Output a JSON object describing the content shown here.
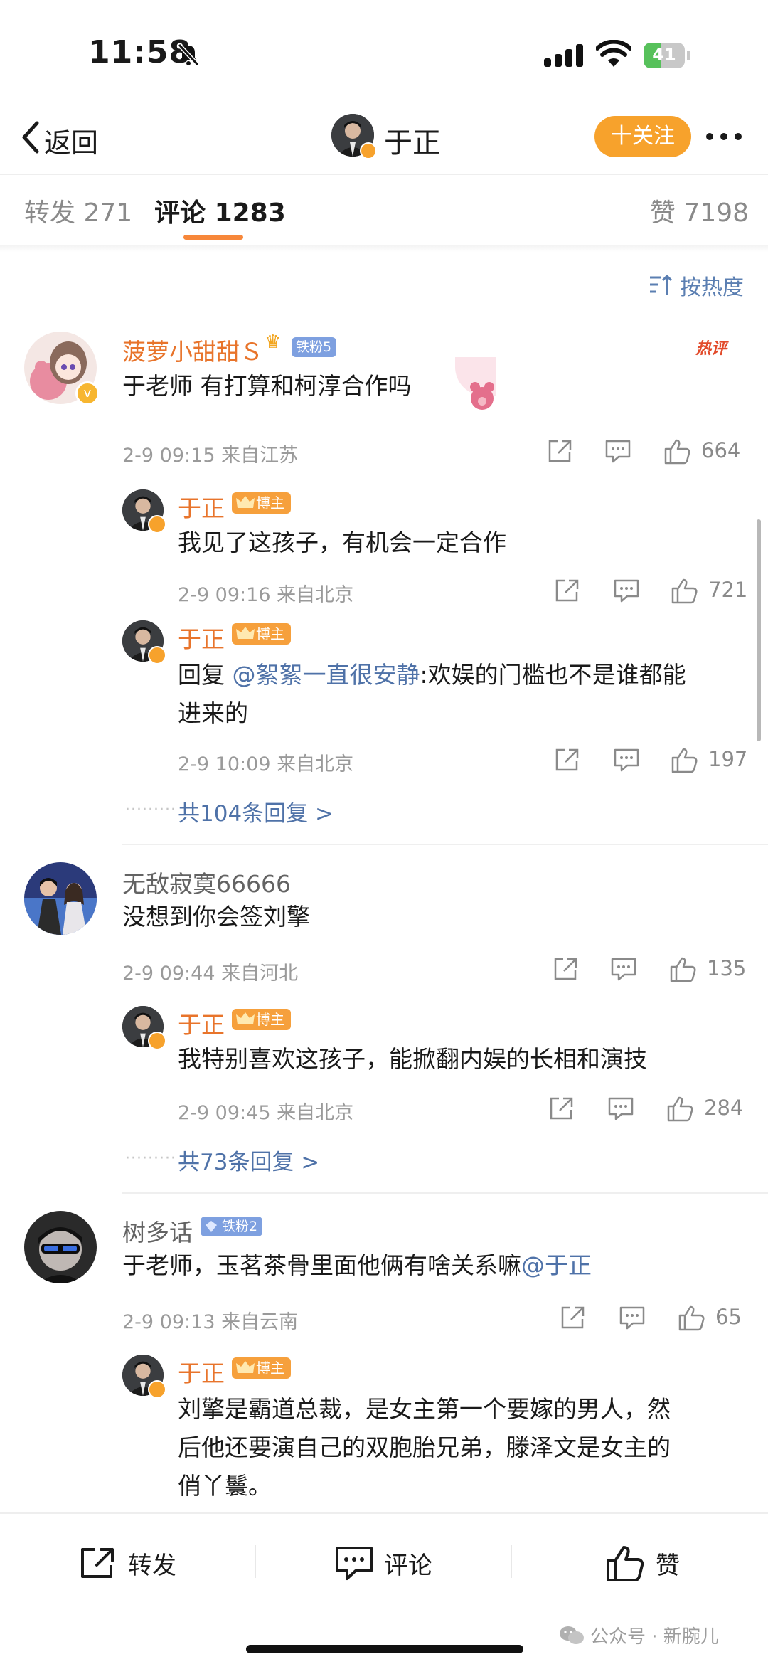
{
  "status_bar": {
    "time": "11:58",
    "battery_level": "41",
    "battery_fraction": 0.41,
    "battery_color": "#57c15b"
  },
  "header": {
    "back_label": "返回",
    "title": "于正",
    "follow_label": "十关注"
  },
  "tabs": [
    {
      "label": "转发",
      "count": "271"
    },
    {
      "label": "评论",
      "count": "1283"
    },
    {
      "label": "赞",
      "count": "7198"
    }
  ],
  "sort": {
    "label": "按热度"
  },
  "comments": [
    {
      "user": "菠萝小甜甜Ｓ",
      "fan_badge": "铁粉5",
      "hot_tag": "热评",
      "text": "于老师 有打算和柯淳合作吗",
      "time": "2-9 09:15",
      "location": "来自江苏",
      "likes": "664",
      "replies": [
        {
          "user": "于正",
          "badge": "博主",
          "text": "我见了这孩子，有机会一定合作",
          "time": "2-9 09:16",
          "location": "来自北京",
          "likes": "721"
        },
        {
          "user": "于正",
          "badge": "博主",
          "reply_prefix": "回复",
          "mention": "@絮絮一直很安静",
          "text_line1": ":欢娱的门槛也不是谁都能",
          "text_line2": "进来的",
          "time": "2-9 10:09",
          "location": "来自北京",
          "likes": "197"
        }
      ],
      "more_replies": "共104条回复 >"
    },
    {
      "user": "无敌寂寞66666",
      "text": "没想到你会签刘擎",
      "time": "2-9 09:44",
      "location": "来自河北",
      "likes": "135",
      "replies": [
        {
          "user": "于正",
          "badge": "博主",
          "text": "我特别喜欢这孩子，能掀翻内娱的长相和演技",
          "time": "2-9 09:45",
          "location": "来自北京",
          "likes": "284"
        }
      ],
      "more_replies": "共73条回复 >"
    },
    {
      "user": "树多话",
      "fan_badge": "铁粉2",
      "text": "于老师，玉茗茶骨里面他俩有啥关系嘛",
      "mention": "@于正",
      "time": "2-9 09:13",
      "location": "来自云南",
      "likes": "65",
      "replies": [
        {
          "user": "于正",
          "badge": "博主",
          "text_line1": "刘擎是霸道总裁，是女主第一个要嫁的男人，然",
          "text_line2": "后他还要演自己的双胞胎兄弟，滕泽文是女主的",
          "text_line3": "俏丫鬟。"
        }
      ]
    }
  ],
  "bottom_bar": {
    "repost": "转发",
    "comment": "评论",
    "like": "赞"
  },
  "watermark": "公众号 · 新腕儿",
  "colors": {
    "accent": "#f7a22c",
    "link": "#4f72a8",
    "username": "#e8742b"
  }
}
